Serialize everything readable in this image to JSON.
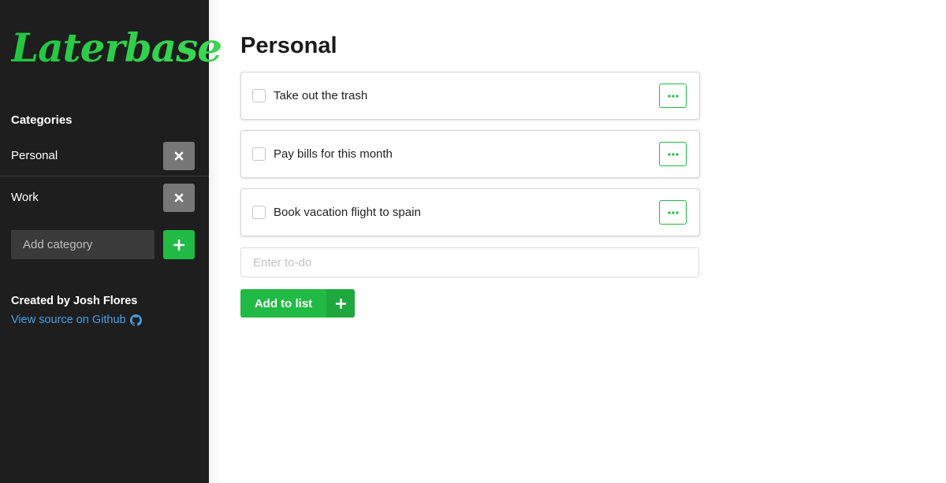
{
  "app": {
    "logo_text": "Laterbase"
  },
  "sidebar": {
    "categories_heading": "Categories",
    "categories": [
      {
        "label": "Personal",
        "delete_icon": "close-icon"
      },
      {
        "label": "Work",
        "delete_icon": "close-icon"
      }
    ],
    "add_category_placeholder": "Add category",
    "add_category_icon": "plus-icon",
    "credit_text": "Created by Josh Flores",
    "source_link_text": "View source on Github",
    "source_link_icon": "github-icon"
  },
  "main": {
    "title": "Personal",
    "todos": [
      {
        "text": "Take out the trash",
        "checked": false,
        "menu_icon": "ellipsis-icon"
      },
      {
        "text": "Pay bills for this month",
        "checked": false,
        "menu_icon": "ellipsis-icon"
      },
      {
        "text": "Book vacation flight to spain",
        "checked": false,
        "menu_icon": "ellipsis-icon"
      }
    ],
    "todo_input_placeholder": "Enter to-do",
    "add_button_label": "Add to list",
    "add_button_icon": "plus-icon"
  },
  "colors": {
    "accent_green": "#21ba45",
    "sidebar_bg": "#1e1e1e",
    "delete_button_bg": "#777777",
    "link_blue": "#4a9fe0"
  }
}
